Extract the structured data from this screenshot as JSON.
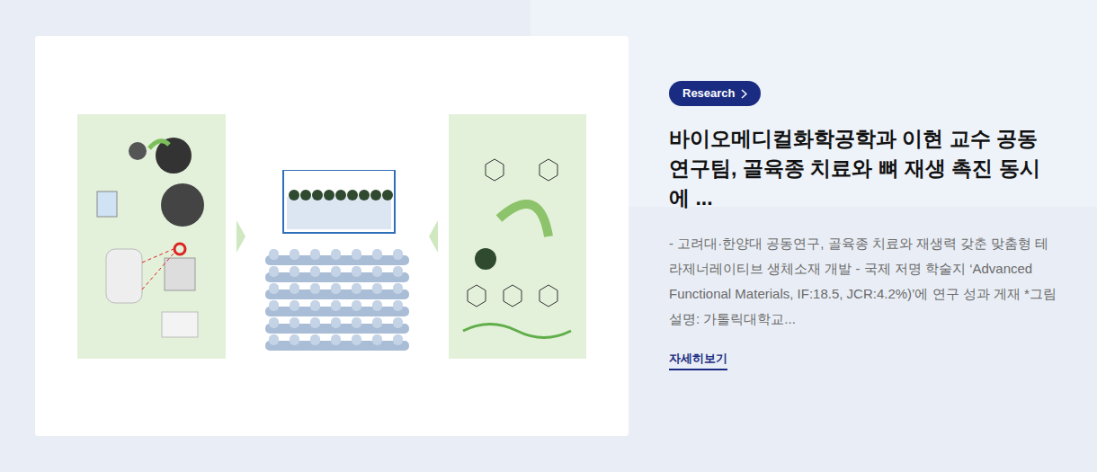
{
  "badge": {
    "label": "Research"
  },
  "article": {
    "title": "바이오메디컬화학공학과 이현 교수 공동 연구팀, 골육종 치료와 뼈 재생 촉진 동시에 ...",
    "summary": "- 고려대·한양대 공동연구, 골육종 치료와 재생력 갖춘 맞춤형 테라제너레이티브 생체소재 개발 - 국제 저명 학술지 ‘Advanced Functional Materials, IF:18.5, JCR:4.2%)’에 연구 성과 게재 *그림 설명: 가톨릭대학교...",
    "more_link": "자세히보기"
  }
}
